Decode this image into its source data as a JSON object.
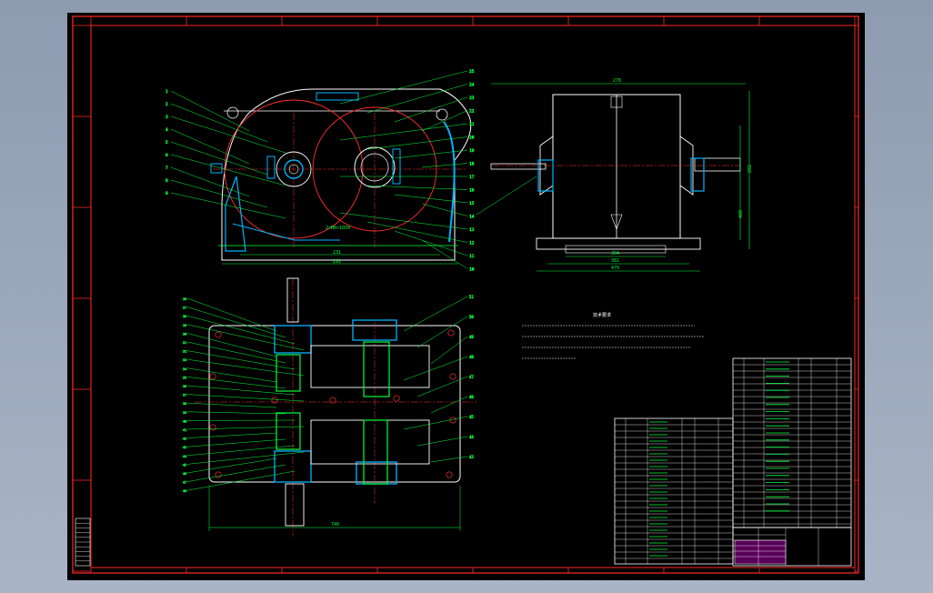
{
  "colors": {
    "background": "#000000",
    "frame": "#ff2a2a",
    "outline": "#ffffff",
    "geometry": "#00ff3c",
    "hatch": "#00b4ff",
    "gear_circle": "#ff3030",
    "accent": "#ffd400",
    "title_fill": "#ff00ff"
  },
  "front_view": {
    "dim_overall": "291",
    "dim_center": "231",
    "note": "2×M8×1050",
    "callouts": [
      "1",
      "2",
      "3",
      "4",
      "5",
      "6",
      "7",
      "8",
      "9"
    ],
    "right_callouts": [
      "25",
      "24",
      "23",
      "22",
      "21",
      "20",
      "19",
      "18",
      "17",
      "16",
      "15",
      "14",
      "13",
      "12",
      "11",
      "10"
    ]
  },
  "side_view": {
    "dim_top": "278",
    "dim_h1": "282",
    "dim_h2": "400",
    "dim_b1": "304",
    "dim_b2": "381",
    "dim_b3": "479"
  },
  "top_view": {
    "dim_width": "740",
    "left_callouts": [
      "26",
      "27",
      "28",
      "29",
      "30",
      "31",
      "32",
      "33",
      "34",
      "35",
      "36",
      "37",
      "38",
      "39",
      "40",
      "41",
      "42",
      "43",
      "44",
      "45",
      "46",
      "47",
      "48"
    ],
    "right_callouts": [
      "51",
      "50",
      "49",
      "48",
      "47",
      "46",
      "45",
      "44",
      "43"
    ]
  },
  "tech_req": {
    "heading": "技术要求"
  }
}
